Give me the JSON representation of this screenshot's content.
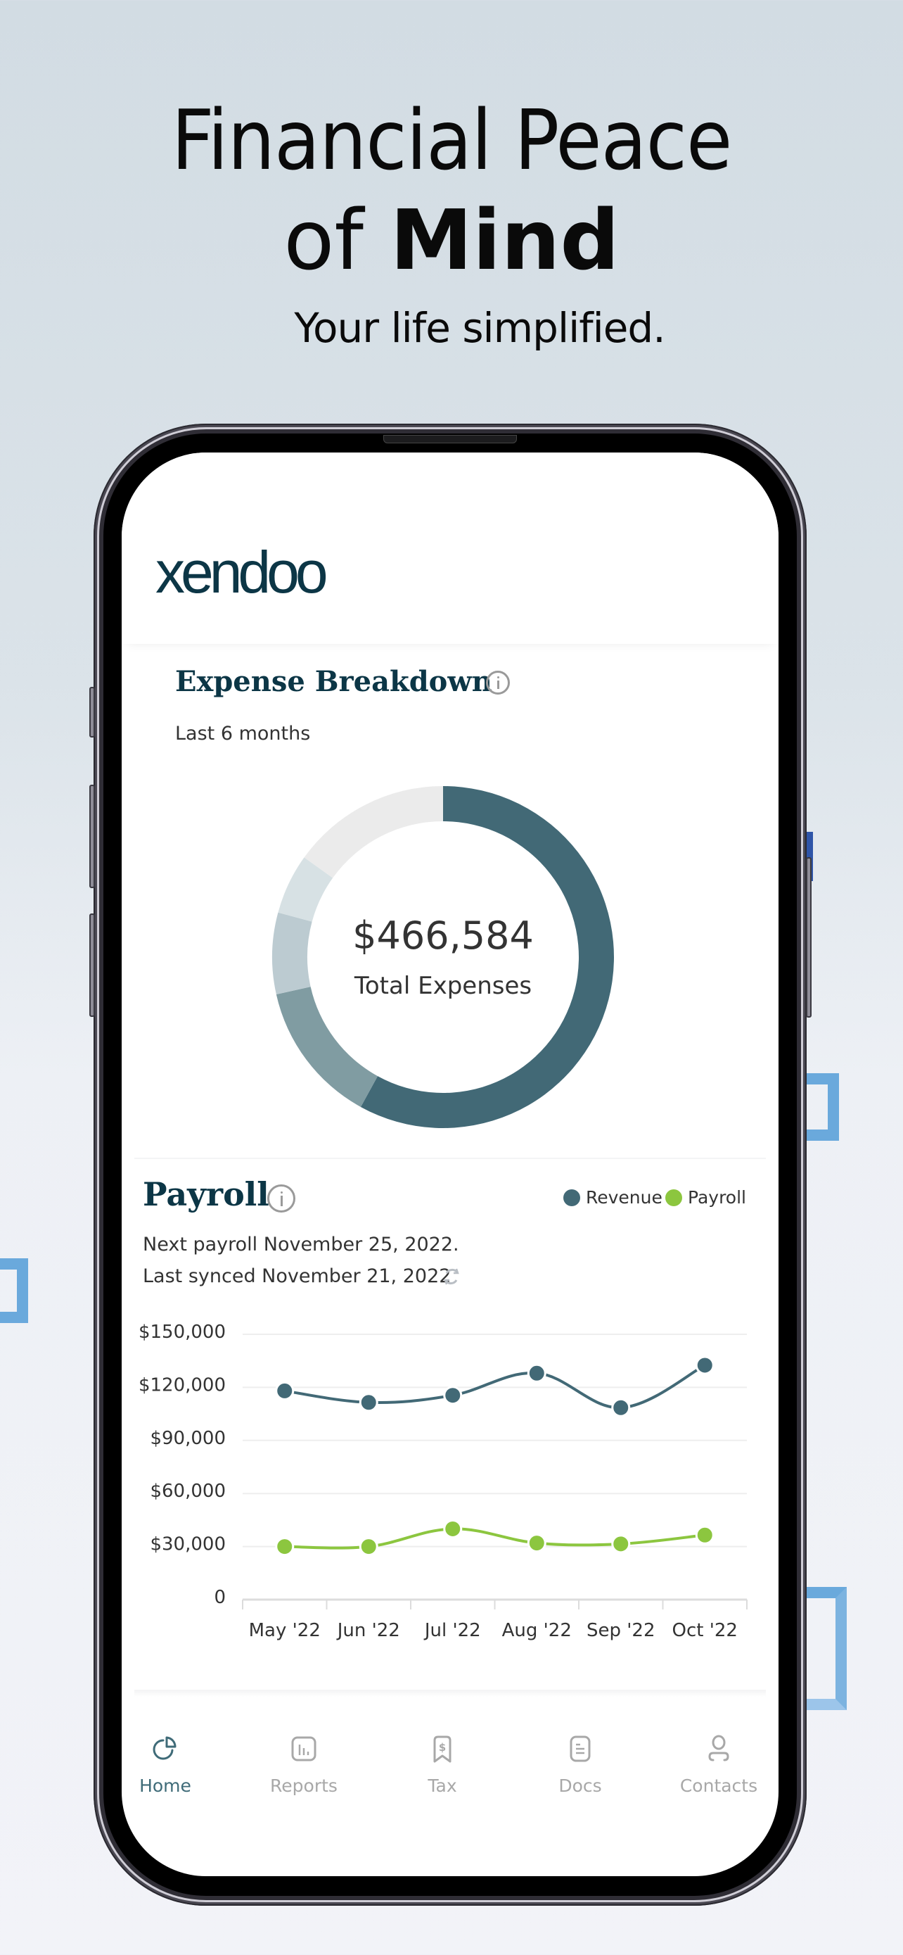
{
  "hero": {
    "line1": "Financial Peace",
    "line2_regular": "of",
    "line2_bold": "Mind",
    "subtitle": "Your life simplified."
  },
  "app": {
    "logo": "xendoo"
  },
  "expense": {
    "title": "Expense Breakdown",
    "subtitle": "Last 6 months",
    "total": "$466,584",
    "total_label": "Total Expenses"
  },
  "payroll": {
    "title": "Payroll",
    "next_payroll": "Next payroll November 25, 2022.",
    "last_synced": "Last synced November 21, 2022",
    "legend": [
      {
        "label": "Revenue",
        "color": "#426976"
      },
      {
        "label": "Payroll",
        "color": "#8cc63f"
      }
    ]
  },
  "tabs": [
    {
      "label": "Home",
      "icon": "pie-chart-icon",
      "active": true
    },
    {
      "label": "Reports",
      "icon": "bar-chart-icon",
      "active": false
    },
    {
      "label": "Tax",
      "icon": "tax-receipt-icon",
      "active": false
    },
    {
      "label": "Docs",
      "icon": "document-icon",
      "active": false
    },
    {
      "label": "Contacts",
      "icon": "person-icon",
      "active": false
    }
  ],
  "colors": {
    "brand_dark": "#0c3646",
    "revenue": "#426976",
    "payroll": "#8cc63f",
    "tab_active": "#3f6b78",
    "tab_inactive": "#a8a8a8"
  },
  "chart_data": [
    {
      "type": "pie",
      "title": "Expense Breakdown",
      "subtitle": "Last 6 months",
      "center_value": "$466,584",
      "center_label": "Total Expenses",
      "donut": true,
      "slices": [
        {
          "share_pct": 58.0,
          "color": "#426976"
        },
        {
          "share_pct": 13.5,
          "color": "#809ca2"
        },
        {
          "share_pct": 7.7,
          "color": "#bccbd1"
        },
        {
          "share_pct": 5.7,
          "color": "#d7e1e4"
        },
        {
          "share_pct": 15.1,
          "color": "#ebebeb"
        }
      ]
    },
    {
      "type": "line",
      "title": "Payroll",
      "categories": [
        "May '22",
        "Jun '22",
        "Jul '22",
        "Aug '22",
        "Sep '22",
        "Oct '22"
      ],
      "series": [
        {
          "name": "Revenue",
          "color": "#426976",
          "values": [
            118000,
            111500,
            115500,
            128000,
            108500,
            132500
          ]
        },
        {
          "name": "Payroll",
          "color": "#8cc63f",
          "values": [
            30000,
            30000,
            40000,
            32000,
            31500,
            36500
          ]
        }
      ],
      "yticks": [
        "0",
        "$30,000",
        "$60,000",
        "$90,000",
        "$120,000",
        "$150,000"
      ],
      "ytick_values": [
        0,
        30000,
        60000,
        90000,
        120000,
        150000
      ],
      "ylim": [
        0,
        150000
      ],
      "xlabel": "",
      "ylabel": "",
      "grid": true,
      "legend": "top-right",
      "smooth": true
    }
  ]
}
